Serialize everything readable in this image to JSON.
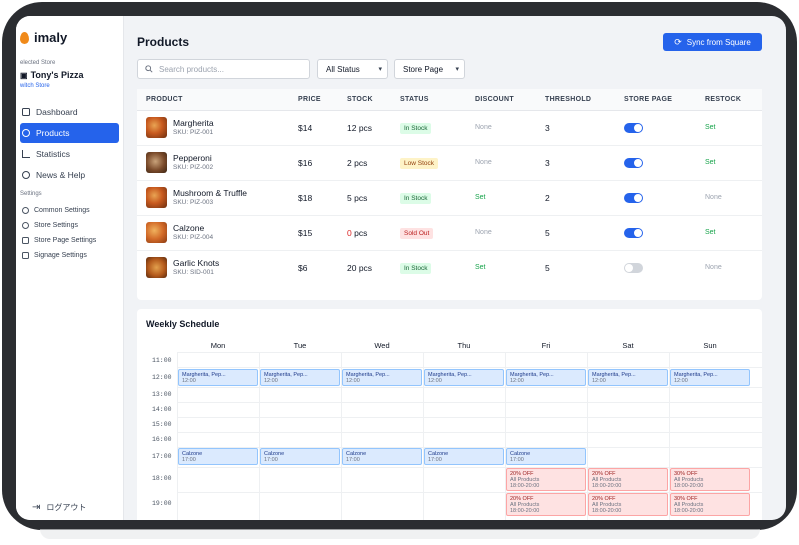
{
  "app": {
    "logo_text": "imaly",
    "brand_color": "#2563eb",
    "logo_color": "#f08a1a"
  },
  "sidebar": {
    "store_caption": "elected Store",
    "store_name": "Tony's Pizza",
    "switch_link": "witch Store",
    "nav": [
      {
        "label": "Dashboard",
        "icon": "dashboard-icon"
      },
      {
        "label": "Products",
        "icon": "box-icon",
        "active": true
      },
      {
        "label": "Statistics",
        "icon": "chart-icon"
      },
      {
        "label": "News & Help",
        "icon": "bell-icon"
      }
    ],
    "settings_caption": "Settings",
    "settings": [
      {
        "label": "Common Settings",
        "icon": "gear-icon"
      },
      {
        "label": "Store Settings",
        "icon": "gear-icon"
      },
      {
        "label": "Store Page Settings",
        "icon": "monitor-icon"
      },
      {
        "label": "Signage Settings",
        "icon": "signage-icon"
      }
    ],
    "logout": "ログアウト"
  },
  "header": {
    "title": "Products",
    "sync_label": "Sync from Square"
  },
  "filters": {
    "search_placeholder": "Search products...",
    "status_value": "All Status",
    "page_value": "Store Page"
  },
  "table": {
    "columns": [
      "PRODUCT",
      "PRICE",
      "STOCK",
      "STATUS",
      "DISCOUNT",
      "THRESHOLD",
      "STORE PAGE",
      "RESTOCK"
    ],
    "rows": [
      {
        "name": "Margherita",
        "sku": "SKU: PIZ-001",
        "price": "$14",
        "stock": "12 pcs",
        "status": "In Stock",
        "status_kind": "green",
        "discount": "None",
        "threshold": "3",
        "store_page": true,
        "restock": "Set"
      },
      {
        "name": "Pepperoni",
        "sku": "SKU: PIZ-002",
        "price": "$16",
        "stock": "2 pcs",
        "status": "Low Stock",
        "status_kind": "yellow",
        "discount": "None",
        "threshold": "3",
        "store_page": true,
        "restock": "Set"
      },
      {
        "name": "Mushroom & Truffle",
        "sku": "SKU: PIZ-003",
        "price": "$18",
        "stock": "5 pcs",
        "status": "In Stock",
        "status_kind": "green",
        "discount": "Set",
        "threshold": "2",
        "store_page": true,
        "restock": "None"
      },
      {
        "name": "Calzone",
        "sku": "SKU: PIZ-004",
        "price": "$15",
        "stock_num": "0",
        "stock_unit": " pcs",
        "status": "Sold Out",
        "status_kind": "red",
        "discount": "None",
        "threshold": "5",
        "store_page": true,
        "restock": "Set"
      },
      {
        "name": "Garlic Knots",
        "sku": "SKU: SID-001",
        "price": "$6",
        "stock": "20 pcs",
        "status": "In Stock",
        "status_kind": "green",
        "discount": "Set",
        "threshold": "5",
        "store_page": false,
        "restock": "None"
      }
    ]
  },
  "schedule": {
    "title": "Weekly Schedule",
    "days": [
      "Mon",
      "Tue",
      "Wed",
      "Thu",
      "Fri",
      "Sat",
      "Sun"
    ],
    "times": [
      "11:00",
      "12:00",
      "13:00",
      "14:00",
      "15:00",
      "16:00",
      "17:00",
      "18:00",
      "19:00"
    ],
    "margherita": {
      "title": "Margherita, Pep...",
      "time": "12:00"
    },
    "calzone": {
      "title": "Calzone",
      "time": "17:00"
    },
    "promo_20": {
      "title": "20% OFF",
      "scope": "All Products",
      "time": "18:00-20:00"
    },
    "promo_30": {
      "title": "30% OFF",
      "scope": "All Products",
      "time": "18:00-20:00"
    }
  }
}
